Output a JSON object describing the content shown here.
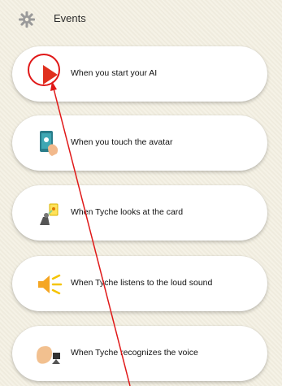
{
  "header": {
    "title": "Events",
    "icon": "gear-icon"
  },
  "events": [
    {
      "label": "When you start your AI",
      "icon": "play-icon"
    },
    {
      "label": "When you touch the avatar",
      "icon": "touch-tablet-icon"
    },
    {
      "label": "When Tyche looks at the card",
      "icon": "robot-card-icon"
    },
    {
      "label": "When Tyche listens to the loud sound",
      "icon": "loud-sound-icon"
    },
    {
      "label": "When Tyche recognizes the voice",
      "icon": "voice-recognition-icon"
    }
  ],
  "colors": {
    "annotation": "#e01818",
    "play": "#e0301e",
    "background": "#f3efe1"
  }
}
